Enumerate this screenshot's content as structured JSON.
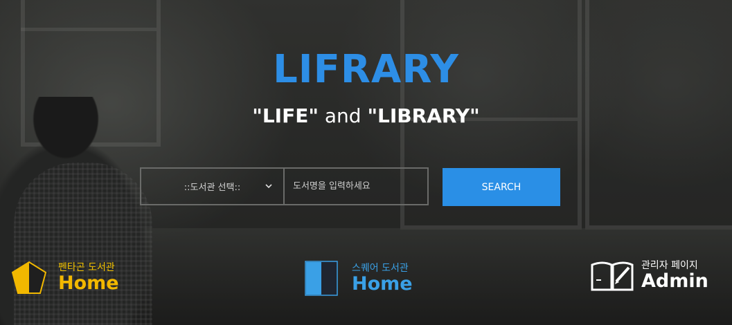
{
  "hero": {
    "brand": "LIFRARY",
    "tagline_part1": "\"LIFE\"",
    "tagline_and": " and ",
    "tagline_part2": "\"LIBRARY\""
  },
  "search": {
    "library_select": "::도서관 선택::",
    "input_placeholder": "도서명을 입력하세요",
    "button_label": "SEARCH"
  },
  "links": [
    {
      "sub": "펜타곤 도서관",
      "label": "Home",
      "icon": "pentagon-icon",
      "color": "#f2b800"
    },
    {
      "sub": "스퀘어 도서관",
      "label": "Home",
      "icon": "square-icon",
      "color": "#3aa0e6"
    },
    {
      "sub": "관리자 페이지",
      "label": "Admin",
      "icon": "book-pen-icon",
      "color": "#ffffff"
    }
  ],
  "colors": {
    "accent": "#2a8fe6",
    "brand": "#2d8ee6"
  }
}
